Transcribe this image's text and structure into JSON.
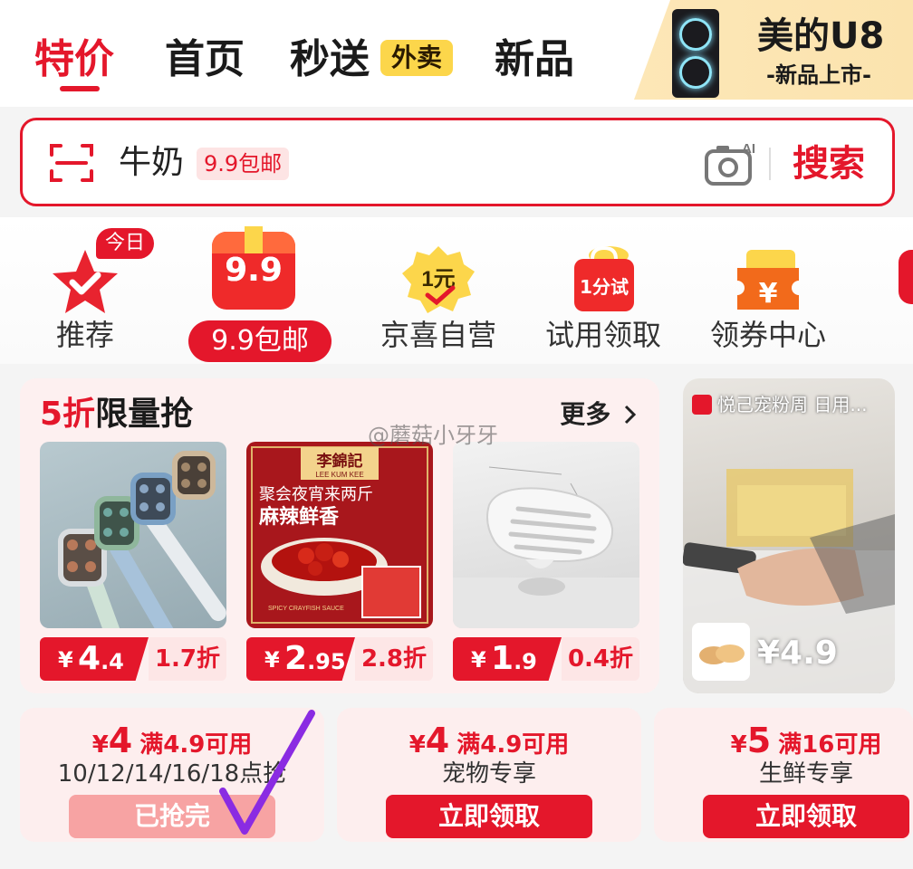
{
  "nav": {
    "tabs": [
      {
        "label": "特价"
      },
      {
        "label": "首页"
      },
      {
        "label": "秒送"
      },
      {
        "label": "新品"
      }
    ],
    "takeout_badge": "外卖",
    "promo": {
      "title": "美的U8",
      "subtitle": "-新品上市-"
    }
  },
  "search": {
    "query": "牛奶",
    "tag": "9.9包邮",
    "camera_ai": "AI",
    "button": "搜索"
  },
  "categories": [
    {
      "label": "推荐",
      "badge": "今日",
      "icon": "star-check-icon"
    },
    {
      "label": "9.9包邮",
      "icon_text": "9.9",
      "icon": "gift-box-icon"
    },
    {
      "label": "京喜自营",
      "icon_text": "1元",
      "icon": "coin-badge-icon"
    },
    {
      "label": "试用领取",
      "icon_text": "1分试",
      "icon": "shopping-bag-icon"
    },
    {
      "label": "领券中心",
      "icon_text": "¥",
      "icon": "coupon-ticket-icon"
    }
  ],
  "flash_sale": {
    "title_red": "5折",
    "title_rest": "限量抢",
    "more": "更多",
    "items": [
      {
        "name": "toothbrush",
        "yen": "¥",
        "price_int": "4",
        "price_dec": ".4",
        "discount": "1.7折"
      },
      {
        "name": "crayfish-sauce",
        "yen": "¥",
        "price_int": "2",
        "price_dec": ".95",
        "discount": "2.8折",
        "brand": "李錦記",
        "brand_en": "LEE KUM KEE",
        "line1": "聚会夜宵来两斤",
        "line2": "麻辣鲜香",
        "en": "SPICY CRAYFISH SAUCE"
      },
      {
        "name": "soap-dish",
        "yen": "¥",
        "price_int": "1",
        "price_dec": ".9",
        "discount": "0.4折"
      }
    ]
  },
  "live": {
    "title": "悦己宠粉周 日用...",
    "price": "¥4.9"
  },
  "coupons": [
    {
      "yen": "¥",
      "value": "4",
      "cond": "满4.9可用",
      "desc": "10/12/14/16/18点抢",
      "button": "已抢完",
      "state": "done"
    },
    {
      "yen": "¥",
      "value": "4",
      "cond": "满4.9可用",
      "desc": "宠物专享",
      "button": "立即领取",
      "state": "active"
    },
    {
      "yen": "¥",
      "value": "5",
      "cond": "满16可用",
      "desc": "生鲜专享",
      "button": "立即领取",
      "state": "active"
    }
  ],
  "watermark": "@蘑菇小牙牙",
  "colors": {
    "brand_red": "#e4172b",
    "takeout_yellow": "#fcd64b",
    "annotation_purple": "#8a2be2"
  }
}
